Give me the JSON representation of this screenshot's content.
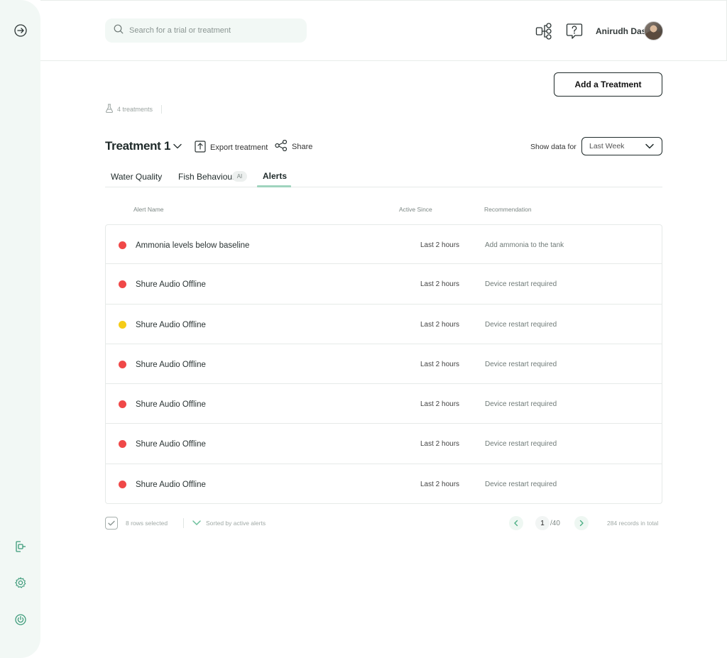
{
  "header": {
    "search_placeholder": "Search for a trial or treatment",
    "user_name": "Anirudh Das"
  },
  "toolbar": {
    "add_button": "Add a Treatment",
    "treatments_count": "4 treatments"
  },
  "treatment": {
    "title": "Treatment 1",
    "export_label": "Export treatment",
    "share_label": "Share",
    "show_data_label": "Show data for",
    "range_selected": "Last Week"
  },
  "tabs": [
    {
      "label": "Water Quality",
      "active": false
    },
    {
      "label": "Fish Behaviour",
      "badge": "AI",
      "active": false
    },
    {
      "label": "Alerts",
      "active": true
    }
  ],
  "table": {
    "columns": [
      "Alert Name",
      "Active Since",
      "Recommendation"
    ],
    "rows": [
      {
        "severity": "red",
        "name": "Ammonia levels below baseline",
        "since": "Last 2 hours",
        "recommendation": "Add ammonia to the tank"
      },
      {
        "severity": "red",
        "name": "Shure Audio Offline",
        "since": "Last 2 hours",
        "recommendation": "Device restart required"
      },
      {
        "severity": "yellow",
        "name": "Shure Audio Offline",
        "since": "Last 2 hours",
        "recommendation": "Device restart required"
      },
      {
        "severity": "red",
        "name": "Shure Audio Offline",
        "since": "Last 2 hours",
        "recommendation": "Device restart required"
      },
      {
        "severity": "red",
        "name": "Shure Audio Offline",
        "since": "Last 2 hours",
        "recommendation": "Device restart required"
      },
      {
        "severity": "red",
        "name": "Shure Audio Offline",
        "since": "Last 2 hours",
        "recommendation": "Device restart required"
      },
      {
        "severity": "red",
        "name": "Shure Audio Offline",
        "since": "Last 2 hours",
        "recommendation": "Device restart required"
      }
    ]
  },
  "footer": {
    "selected": "8 rows selected",
    "sorted": "Sorted  by active alerts",
    "page": "1",
    "pages": "/40",
    "total": "284 records in total"
  },
  "colors": {
    "accent": "#9fd4be",
    "red": "#f04848",
    "yellow": "#f5cc17",
    "sidebar_bg": "#f2f8f5"
  },
  "icons": {
    "sidebar": [
      "expand-arrow-icon",
      "logout-icon",
      "settings-gear-icon",
      "power-icon"
    ],
    "header": [
      "search-icon",
      "workflow-nodes-icon",
      "help-chat-icon"
    ]
  }
}
